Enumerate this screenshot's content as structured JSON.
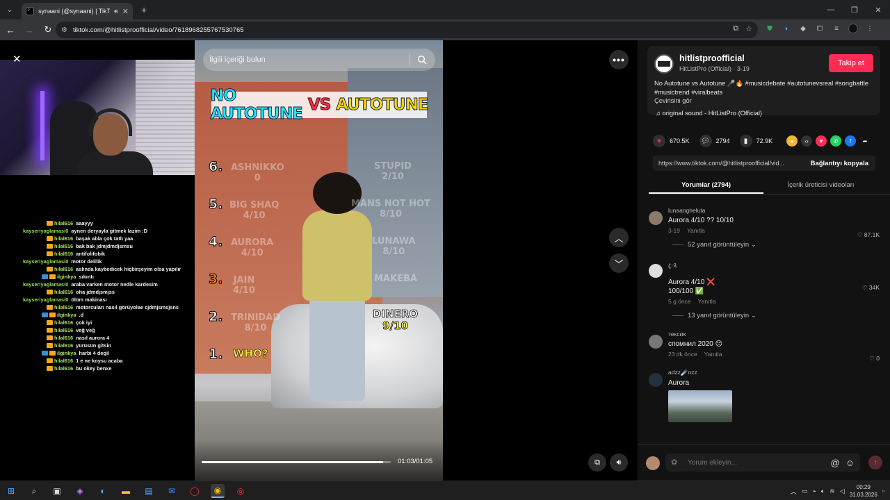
{
  "browser": {
    "tab_title": "synaani (@synaani) | TikTok",
    "new_tab": "+",
    "url": "tiktok.com/@hitlistproofficial/video/7618968255767530765",
    "window_controls": [
      "—",
      "❐",
      "✕"
    ]
  },
  "video": {
    "search_placeholder": "İlgili içeriği bulun",
    "title_part1": "NO AUTOTUNE",
    "title_vs": "VS",
    "title_part2": "AUTOTUNE",
    "ranks": [
      {
        "n": "6.",
        "left": "ASHNIKKO\n0",
        "right": "STUPID\n2/10"
      },
      {
        "n": "5.",
        "left": "BIG SHAQ\n4/10",
        "right": "MANS NOT HOT\n8/10"
      },
      {
        "n": "4.",
        "left": "AURORA\n4/10",
        "right": "LUNAWA\n8/10"
      },
      {
        "n": "3.",
        "left": "JAIN\n4/10",
        "right": "MAKEBA"
      },
      {
        "n": "2.",
        "left": "TRINIDAD\n8/10",
        "right": ""
      },
      {
        "n": "1.",
        "left": "",
        "right": ""
      }
    ],
    "who": "WHO?",
    "dinero_name": "DINERO",
    "dinero_score": "9/10",
    "progress_fraction": 0.96,
    "time": "01:03/01:05"
  },
  "chat": [
    {
      "user": "hilal616",
      "cls": "user-hilal",
      "badge": "b1",
      "msg": "aaayyy"
    },
    {
      "user": "kayseriyaglamasi0",
      "cls": "user-kay",
      "badge": "",
      "msg": "aynen deryayla gitmek lazim :D"
    },
    {
      "user": "hilal616",
      "cls": "user-hilal",
      "badge": "b1",
      "msg": "başak abla çok tatlı yaa"
    },
    {
      "user": "hilal616",
      "cls": "user-hilal",
      "badge": "b1",
      "msg": "bak bak jdmjdmdjsmsu"
    },
    {
      "user": "hilal616",
      "cls": "user-hilal",
      "badge": "b1",
      "msg": "antifolifobik"
    },
    {
      "user": "kayseriyaglamasi0",
      "cls": "user-kay",
      "badge": "",
      "msg": "motor delilik"
    },
    {
      "user": "hilal616",
      "cls": "user-hilal",
      "badge": "b1",
      "msg": "aslında kaybedicek hiçbirşeyim olsa yapılır"
    },
    {
      "user": "ilginkya",
      "cls": "user-ilg",
      "badge": "b2",
      "msg": "sıkıntı"
    },
    {
      "user": "kayseriyaglamasi0",
      "cls": "user-kay",
      "badge": "",
      "msg": "araba varken motor nedle kardesim"
    },
    {
      "user": "hilal616",
      "cls": "user-hilal",
      "badge": "b1",
      "msg": "oha jdmdjsmjss"
    },
    {
      "user": "kayseriyaglamasi0",
      "cls": "user-kay",
      "badge": "",
      "msg": "ölüm makinası"
    },
    {
      "user": "hilal616",
      "cls": "user-hilal",
      "badge": "b1",
      "msg": "motorcuları nasıl görüyolae cjdmjsmsjsns"
    },
    {
      "user": "ilginkya",
      "cls": "user-ilg",
      "badge": "b2",
      "msg": ".d"
    },
    {
      "user": "hilal616",
      "cls": "user-hilal",
      "badge": "b1",
      "msg": "çok iyi"
    },
    {
      "user": "hilal616",
      "cls": "user-hilal",
      "badge": "b1",
      "msg": "veğ veğ"
    },
    {
      "user": "hilal616",
      "cls": "user-hilal",
      "badge": "b1",
      "msg": "nasıl aurora 4"
    },
    {
      "user": "hilal616",
      "cls": "user-hilal",
      "badge": "b1",
      "msg": "yürüsün gitsin"
    },
    {
      "user": "ilginkya",
      "cls": "user-ilg",
      "badge": "b2",
      "msg": "harbi 4 degil"
    },
    {
      "user": "hilal616",
      "cls": "user-hilal",
      "badge": "b1",
      "msg": "1 e ne koysu acaba"
    },
    {
      "user": "hilal616",
      "cls": "user-hilal",
      "badge": "b1",
      "msg": "bu okey benxe"
    }
  ],
  "panel": {
    "author_name": "hitlistproofficial",
    "author_sub": "HitListPro (Official) · 3-19",
    "follow": "Takip et",
    "desc": "No Autotune vs Autotune 🎤🔥 #musicdebate #autotunevsreal #songbattle #musictrend #viralbeats",
    "see_translation": "Çevirisini gör",
    "sound": "♫  original sound - HitListPro (Official)",
    "likes": "670.5K",
    "comments_count": "2794",
    "saves": "72.9K",
    "link_url": "https://www.tiktok.com/@hitlistproofficial/vid...",
    "copy_link": "Bağlantıyı kopyala",
    "tab_comments": "Yorumlar (2794)",
    "tab_creator": "İçerik üreticisi videoları",
    "comment_placeholder": "Yorum ekleyin..."
  },
  "comments": [
    {
      "user": "lunaangheluta",
      "text": "Aurora 4/10 ?? 10/10",
      "date": "3-19",
      "reply": "Yanıtla",
      "likes": "87.1K",
      "more": "52 yanıt görüntüleyin ⌄",
      "avatar": "#8a7a6a"
    },
    {
      "user": "ꦿ༉",
      "text": "Aurora 4/10 ❌\n100/100 ✅",
      "date": "5 g önce",
      "reply": "Yanıtla",
      "likes": "34K",
      "more": "13 yanıt görüntüleyin ⌄",
      "avatar": "#dddddd"
    },
    {
      "user": "тексик",
      "text": "спомнил 2020 😔",
      "date": "23 dk önce",
      "reply": "Yanıtla",
      "likes": "0",
      "more": "",
      "avatar": "#777777"
    },
    {
      "user": "adzz☄️ozz",
      "text": "Aurora",
      "date": "",
      "reply": "",
      "likes": "",
      "more": "",
      "avatar": "#223040"
    }
  ],
  "taskbar": {
    "time": "00:29",
    "date": "31.03.2026"
  }
}
